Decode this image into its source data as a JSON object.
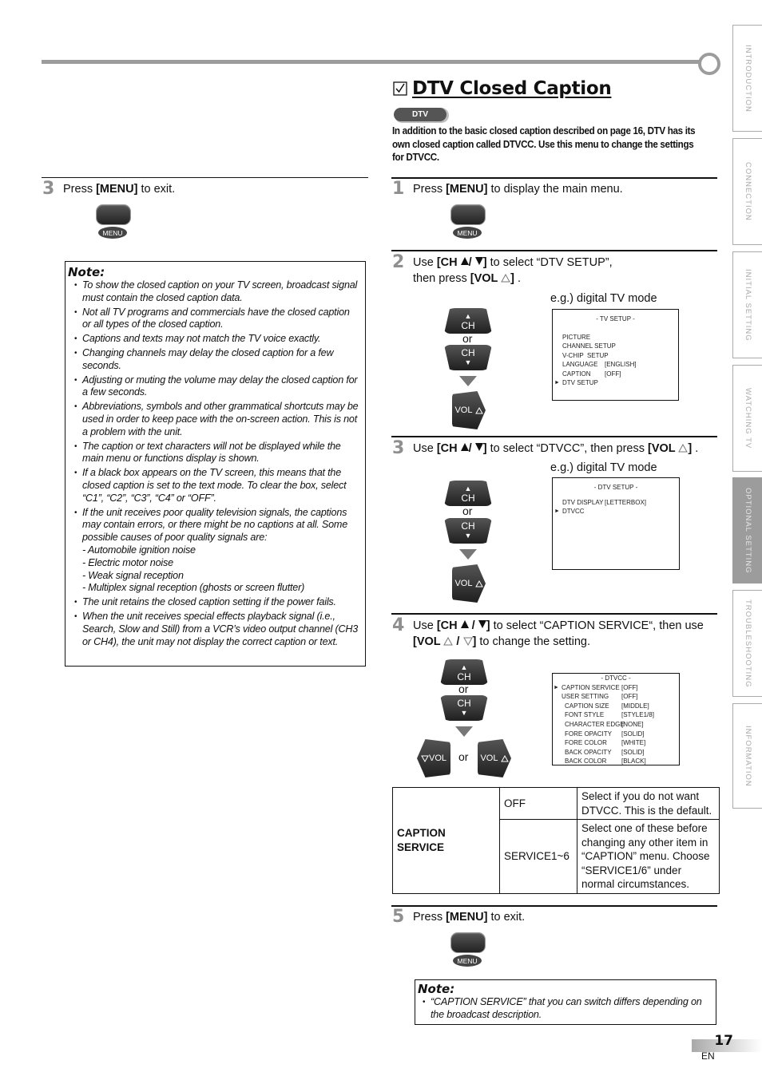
{
  "side_tabs": [
    {
      "label": "INTRODUCTION",
      "active": false
    },
    {
      "label": "CONNECTION",
      "active": false
    },
    {
      "label": "INITIAL  SETTING",
      "active": false
    },
    {
      "label": "WATCHING  TV",
      "active": false
    },
    {
      "label": "OPTIONAL  SETTING",
      "active": true
    },
    {
      "label": "TROUBLESHOOTING",
      "active": false
    },
    {
      "label": "INFORMATION",
      "active": false
    }
  ],
  "left_column": {
    "step3": {
      "number": "3",
      "text_before": "Press ",
      "key": "[MENU]",
      "text_after": " to exit.",
      "button_label": "MENU"
    },
    "note": {
      "title": "Note:",
      "items": [
        "To show the closed caption on your TV screen, broadcast signal must contain the closed caption data.",
        "Not all TV programs and commercials have the closed caption or all types of the closed caption.",
        "Captions and texts may not match the TV voice exactly.",
        "Changing channels may delay the closed caption for a few seconds.",
        "Adjusting or muting the volume may delay the closed caption for a few seconds.",
        "Abbreviations, symbols and other grammatical shortcuts may be used in order to keep pace with the on-screen action. This is not a problem with the unit.",
        "The caption or text characters will not be displayed while the main menu or functions display is shown.",
        "If a black box appears on the TV screen, this means that the closed caption is set to the text mode. To clear the box, select “C1”, “C2”, “C3”, “C4” or “OFF”.",
        "If the unit receives poor quality television signals, the captions may contain errors, or there might be no captions at all. Some possible causes of poor quality signals are:"
      ],
      "sub_items": [
        "- Automobile ignition noise",
        "- Electric motor noise",
        "- Weak signal reception",
        "- Multiplex signal reception (ghosts or screen flutter)"
      ],
      "items_after": [
        "The unit retains the closed caption setting if the power fails.",
        "When the unit receives special effects playback signal (i.e., Search, Slow and Still) from a VCR’s video output channel (CH3 or CH4), the unit may not display the correct caption or text."
      ]
    }
  },
  "section": {
    "title": "DTV Closed Caption",
    "badge": "DTV",
    "intro": "In addition to the basic closed caption described on page 16, DTV has its own closed caption called DTVCC. Use this menu to change the settings for DTVCC."
  },
  "steps": {
    "s1": {
      "number": "1",
      "pre": "Press ",
      "key": "[MENU]",
      "post": " to display the main menu.",
      "button_label": "MENU"
    },
    "s2": {
      "number": "2",
      "pre": "Use ",
      "key1": "[CH ",
      "key1_end": "/ ",
      "key1_close": "]",
      "mid": " to select “DTV SETUP”,",
      "line2_pre": "then press ",
      "key2": "[VOL ",
      "key2_close": "]",
      "line2_post": " .",
      "eg_label": "e.g.) digital TV mode",
      "ch_label": "CH",
      "or_label": "or",
      "vol_label": "VOL",
      "osd": {
        "title": "-  TV SETUP  -",
        "rows": [
          {
            "label": "PICTURE",
            "value": "",
            "selected": false
          },
          {
            "label": "CHANNEL SETUP",
            "value": "",
            "selected": false
          },
          {
            "label": "V-CHIP  SETUP",
            "value": "",
            "selected": false
          },
          {
            "label": "LANGUAGE",
            "value": "[ENGLISH]",
            "selected": false
          },
          {
            "label": "CAPTION",
            "value": "[OFF]",
            "selected": false
          },
          {
            "label": "DTV SETUP",
            "value": "",
            "selected": true
          }
        ]
      }
    },
    "s3": {
      "number": "3",
      "pre": "Use ",
      "key1": "[CH ",
      "key1_end": "/ ",
      "key1_close": "]",
      "mid": " to select “DTVCC”, then press ",
      "key2": "[VOL ",
      "key2_close": "]",
      "post": " .",
      "eg_label": "e.g.) digital TV mode",
      "ch_label": "CH",
      "or_label": "or",
      "vol_label": "VOL",
      "osd": {
        "title": "-  DTV SETUP  -",
        "rows": [
          {
            "label": "DTV DISPLAY",
            "value": "[LETTERBOX]",
            "selected": false
          },
          {
            "label": "DTVCC",
            "value": "",
            "selected": true
          }
        ]
      }
    },
    "s4": {
      "number": "4",
      "pre": "Use ",
      "key1": "[CH ",
      "key1_end": " / ",
      "key1_close": "]",
      "mid": " to select “CAPTION SERVICE“, then use",
      "key2": "[VOL ",
      "key2_sep": " / ",
      "key2_close": "]",
      "post": " to change the setting.",
      "ch_label": "CH",
      "or_label": "or",
      "vol_label": "VOL",
      "osd": {
        "title": "- DTVCC -",
        "rows": [
          {
            "label": "CAPTION SERVICE",
            "value": "[OFF]",
            "selected": true,
            "indent": 0
          },
          {
            "label": "USER SETTING",
            "value": "[OFF]",
            "selected": false,
            "indent": 0
          },
          {
            "label": "CAPTION SIZE",
            "value": "[MIDDLE]",
            "selected": false,
            "indent": 1
          },
          {
            "label": "FONT STYLE",
            "value": "[STYLE1/8]",
            "selected": false,
            "indent": 1
          },
          {
            "label": "CHARACTER EDGE",
            "value": "[NONE]",
            "selected": false,
            "indent": 1
          },
          {
            "label": "FORE OPACITY",
            "value": "[SOLID]",
            "selected": false,
            "indent": 1
          },
          {
            "label": "FORE COLOR",
            "value": "[WHITE]",
            "selected": false,
            "indent": 1
          },
          {
            "label": "BACK OPACITY",
            "value": "[SOLID]",
            "selected": false,
            "indent": 1
          },
          {
            "label": "BACK COLOR",
            "value": "[BLACK]",
            "selected": false,
            "indent": 1
          }
        ]
      },
      "table": {
        "header": "CAPTION SERVICE",
        "rows": [
          {
            "option": "OFF",
            "description": "Select if you do not want DTVCC. This is the default."
          },
          {
            "option": "SERVICE1~6",
            "description": "Select one of these before changing any other item in “CAPTION” menu. Choose “SERVICE1/6” under normal circumstances."
          }
        ]
      }
    },
    "s5": {
      "number": "5",
      "pre": "Press ",
      "key": "[MENU]",
      "post": " to exit.",
      "button_label": "MENU"
    }
  },
  "bottom_note": {
    "title": "Note:",
    "items": [
      "“CAPTION SERVICE” that you can switch differs depending on the broadcast description."
    ]
  },
  "footer": {
    "page_number": "17",
    "language": "EN"
  },
  "colors": {
    "accent_gray": "#9c9c9c",
    "active_tab": "#9c9c9c",
    "step_number": "#8f8f8f"
  }
}
